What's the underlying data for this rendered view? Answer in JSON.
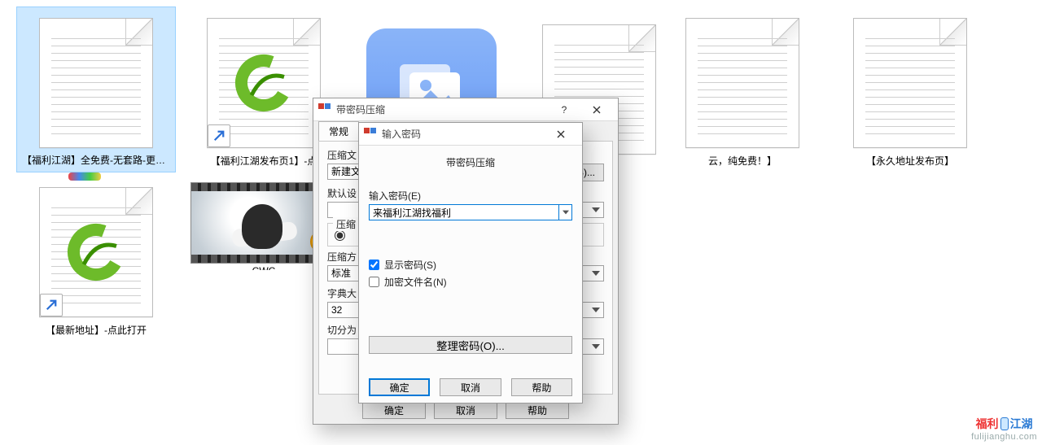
{
  "files": [
    {
      "label": "【福利江湖】全免费-无套路-更新快",
      "type": "text",
      "selected": true
    },
    {
      "label": "【福利江湖发布页1】-点",
      "type": "url"
    },
    {
      "label": "",
      "type": "pictures"
    },
    {
      "label": "",
      "type": "text"
    },
    {
      "label": "云，纯免费！】",
      "type": "text"
    },
    {
      "label": "【永久地址发布页】",
      "type": "text"
    },
    {
      "label": "【最新地址】-点此打开",
      "type": "url"
    },
    {
      "label": "CWC",
      "type": "video"
    }
  ],
  "back_dialog": {
    "title": "带密码压缩",
    "tab": "常规",
    "file_label": "压缩文",
    "file_value": "新建文",
    "browse": "(B)...",
    "default_label": "默认设",
    "compress_group": "压缩",
    "method_label": "压缩方",
    "method_value": "标准",
    "dict_label": "字典大",
    "dict_value": "32",
    "split_label": "切分为",
    "ok": "确定",
    "cancel": "取消",
    "help": "帮助"
  },
  "front_dialog": {
    "title": "输入密码",
    "heading": "带密码压缩",
    "pw_label": "输入密码(E)",
    "pw_value": "来福利江湖找福利",
    "show_pw": "显示密码(S)",
    "encrypt_names": "加密文件名(N)",
    "organize": "整理密码(O)...",
    "ok": "确定",
    "cancel": "取消",
    "help": "帮助"
  },
  "watermark": {
    "left": "福利",
    "right": "江湖",
    "url": "fulijianghu.com"
  }
}
